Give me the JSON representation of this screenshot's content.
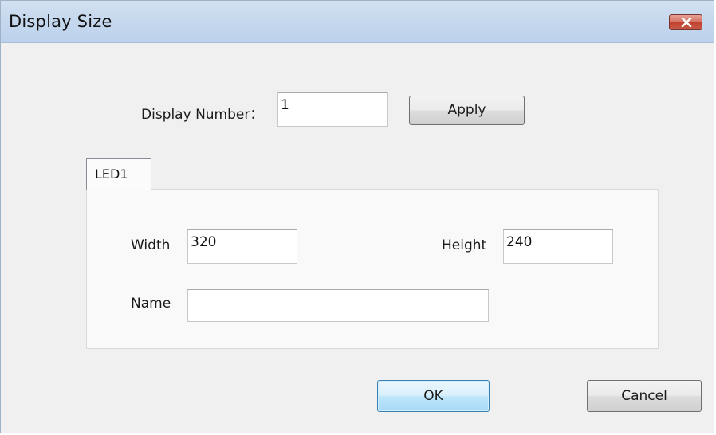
{
  "window": {
    "title": "Display Size",
    "close_icon": "close-icon"
  },
  "display_number": {
    "label": "Display Number：",
    "value": "1",
    "apply_label": "Apply"
  },
  "tabs": [
    {
      "label": "LED1",
      "selected": true
    }
  ],
  "led_panel": {
    "width_label": "Width",
    "width_value": "320",
    "height_label": "Height",
    "height_value": "240",
    "name_label": "Name",
    "name_value": ""
  },
  "footer": {
    "ok_label": "OK",
    "cancel_label": "Cancel"
  },
  "colors": {
    "title_bar": "#c6d8ee",
    "close_button": "#c85b49",
    "default_button_border": "#3c7fb1",
    "window_background": "#f0f0f0"
  }
}
